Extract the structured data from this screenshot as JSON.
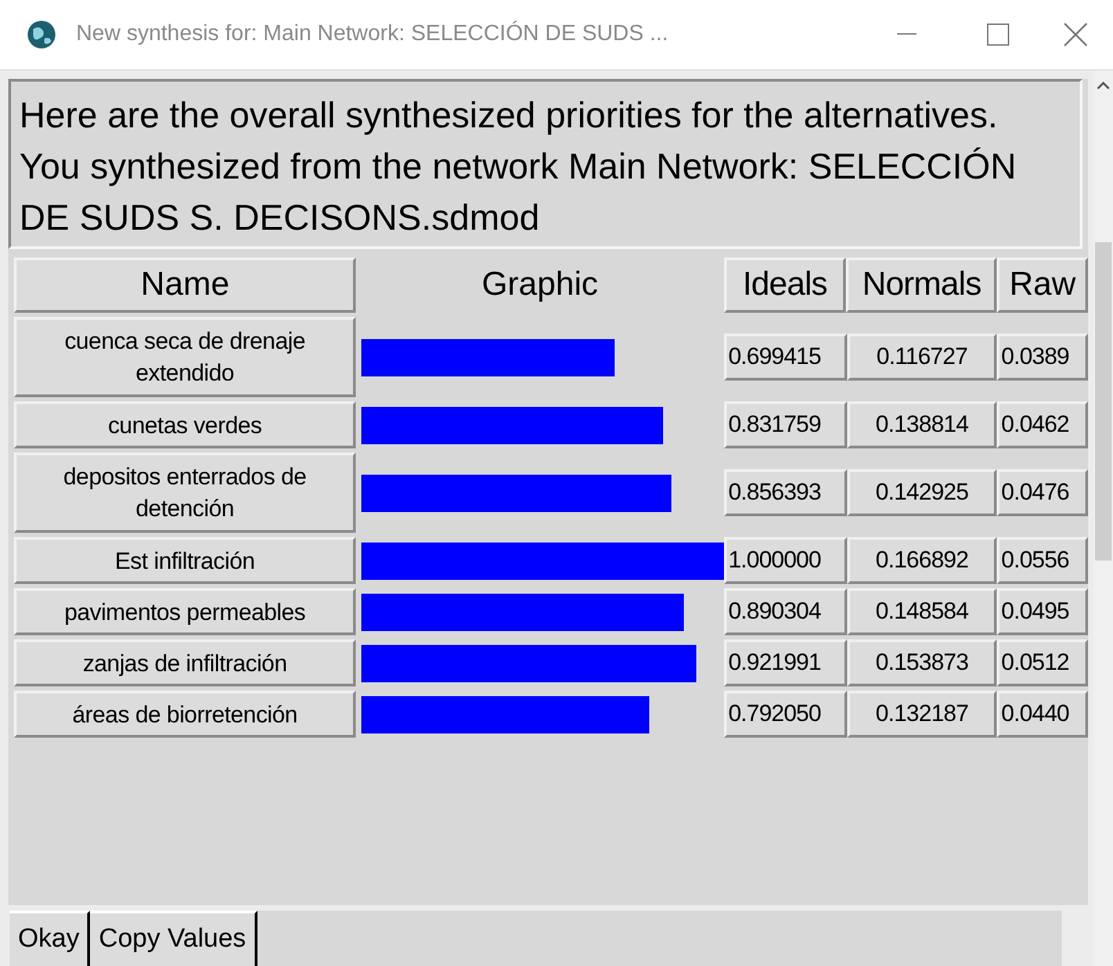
{
  "window": {
    "title": "New synthesis for: Main Network: SELECCIÓN DE SUDS ..."
  },
  "message": "Here are the overall synthesized priorities for the alternatives.  You synthesized from the network Main Network: SELECCIÓN DE SUDS S. DECISONS.sdmod",
  "table": {
    "columns": [
      "Name",
      "Graphic",
      "Ideals",
      "Normals",
      "Raw"
    ],
    "rows": [
      {
        "name": "cuenca seca de drenaje extendido",
        "ideals": "0.699415",
        "normals": "0.116727",
        "raw": "0.0389"
      },
      {
        "name": "cunetas verdes",
        "ideals": "0.831759",
        "normals": "0.138814",
        "raw": "0.0462"
      },
      {
        "name": "depositos enterrados de detención",
        "ideals": "0.856393",
        "normals": "0.142925",
        "raw": "0.0476"
      },
      {
        "name": "Est infiltración",
        "ideals": "1.000000",
        "normals": "0.166892",
        "raw": "0.0556"
      },
      {
        "name": "pavimentos permeables",
        "ideals": "0.890304",
        "normals": "0.148584",
        "raw": "0.0495"
      },
      {
        "name": "zanjas de infiltración",
        "ideals": "0.921991",
        "normals": "0.153873",
        "raw": "0.0512"
      },
      {
        "name": "áreas de biorretención",
        "ideals": "0.792050",
        "normals": "0.132187",
        "raw": "0.0440"
      }
    ]
  },
  "buttons": [
    "Okay",
    "Copy Values"
  ]
}
